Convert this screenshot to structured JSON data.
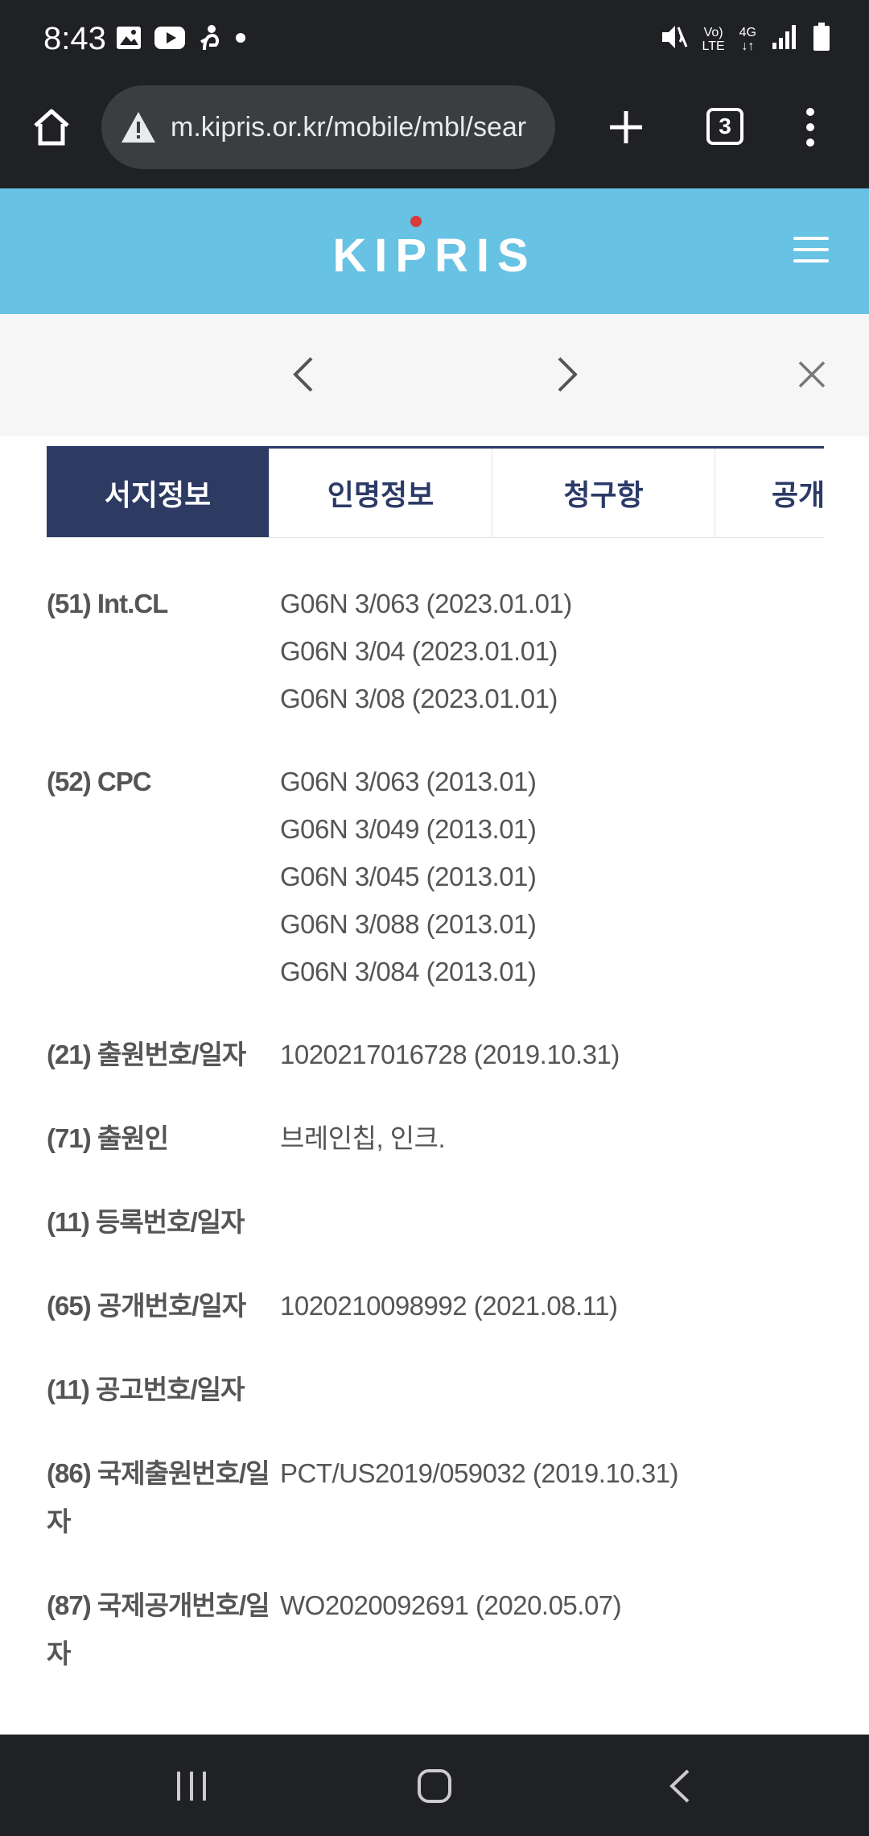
{
  "status_bar": {
    "time": "8:43",
    "left_icons": [
      "gallery-icon",
      "youtube-icon",
      "person-icon",
      "dot-icon"
    ],
    "network_top": "Vo)",
    "network_bottom": "LTE",
    "signal_label": "4G",
    "right_icons": [
      "mute-icon",
      "signal-icon",
      "battery-icon"
    ]
  },
  "browser": {
    "url": "m.kipris.or.kr/mobile/mbl/sear",
    "tab_count": "3"
  },
  "site": {
    "logo": "KIPRIS"
  },
  "tabs": [
    {
      "label": "서지정보",
      "active": true
    },
    {
      "label": "인명정보",
      "active": false
    },
    {
      "label": "청구항",
      "active": false
    },
    {
      "label": "공개",
      "active": false
    }
  ],
  "info": [
    {
      "code": "(51)",
      "label": "Int.CL",
      "values": [
        "G06N 3/063 (2023.01.01)",
        "G06N 3/04 (2023.01.01)",
        "G06N 3/08 (2023.01.01)"
      ]
    },
    {
      "code": "(52)",
      "label": "CPC",
      "values": [
        "G06N 3/063 (2013.01)",
        "G06N 3/049 (2013.01)",
        "G06N 3/045 (2013.01)",
        "G06N 3/088 (2013.01)",
        "G06N 3/084 (2013.01)"
      ]
    },
    {
      "code": "(21)",
      "label": "출원번호/일자",
      "values": [
        "1020217016728 (2019.10.31)"
      ]
    },
    {
      "code": "(71)",
      "label": "출원인",
      "values": [
        "브레인칩, 인크."
      ]
    },
    {
      "code": "(11)",
      "label": "등록번호/일자",
      "values": []
    },
    {
      "code": "(65)",
      "label": "공개번호/일자",
      "values": [
        "1020210098992 (2021.08.11)"
      ]
    },
    {
      "code": "(11)",
      "label": "공고번호/일자",
      "values": []
    },
    {
      "code": "(86)",
      "label": "국제출원번호/일자",
      "values": [
        "PCT/US2019/059032 (2019.10.31)"
      ]
    },
    {
      "code": "(87)",
      "label": "국제공개번호/일자",
      "values": [
        "WO2020092691 (2020.05.07)"
      ]
    }
  ]
}
